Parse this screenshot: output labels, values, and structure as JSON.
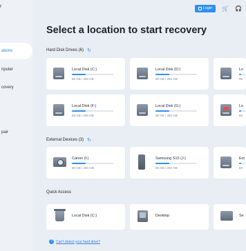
{
  "sidebar": {
    "top_fragment": "r",
    "items": [
      {
        "label": "ations",
        "active": true
      },
      {
        "label": "nputer",
        "active": false
      },
      {
        "label": "covery",
        "active": false
      },
      {
        "label": "pair",
        "active": false
      }
    ]
  },
  "topbar": {
    "login_label": "Login",
    "cart_icon": "cart-icon",
    "support_icon": "headset-icon"
  },
  "title": "Select a location to start recovery",
  "hard_disk": {
    "label": "Hard Disk Drives (6)",
    "drives": [
      {
        "name": "Local Disk (C:)",
        "size": "86 GB / 250 GB",
        "fill": 0.34
      },
      {
        "name": "Local Disk (D:)",
        "size": "86 GB / 250 GB",
        "fill": 0.34
      },
      {
        "name": "Lo",
        "size": "86",
        "fill": 0.34
      },
      {
        "name": "Local Disk (F:)",
        "size": "86 GB / 250 GB",
        "fill": 0.34
      },
      {
        "name": "Local Disk (G:)",
        "size": "86 GB / 250 GB",
        "fill": 0.34
      },
      {
        "name": "Lo",
        "size": "86",
        "fill": 0.34
      }
    ]
  },
  "external": {
    "label": "External Devices (3)",
    "devices": [
      {
        "name": "Canon (I:)",
        "size": "86 GB / 250 GB",
        "fill": 0.34
      },
      {
        "name": "Samsung S10 (J:)",
        "size": "86 GB / 250 GB",
        "fill": 0.34
      },
      {
        "name": "Ext",
        "size": "86",
        "fill": 0.34
      }
    ]
  },
  "quick_access": {
    "label": "Quick Access",
    "items": [
      {
        "name": "Local Disk (C:)"
      },
      {
        "name": "Desktop"
      },
      {
        "name": "Se"
      }
    ]
  },
  "footer": {
    "help_glyph": "?",
    "text": "Can't detect your hard drive?"
  },
  "colors": {
    "accent": "#2f8ff0",
    "background": "#e9eef4",
    "card": "#ffffff",
    "warning": "#e25151"
  }
}
